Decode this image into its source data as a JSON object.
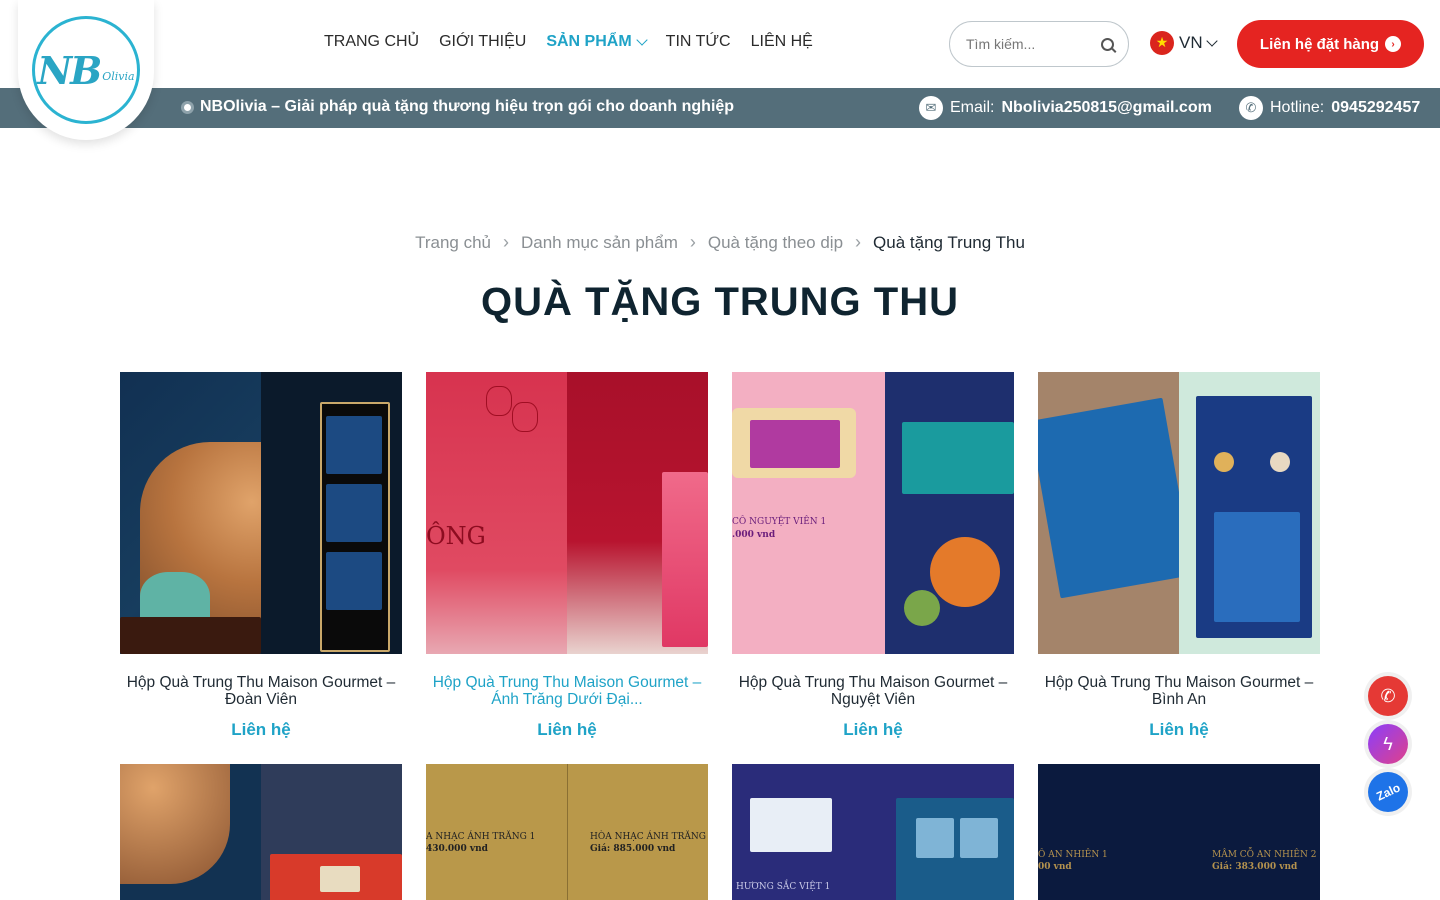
{
  "brand": {
    "logo_text": "NB",
    "logo_sub": "Olivia"
  },
  "nav": {
    "items": [
      {
        "label": "TRANG CHỦ"
      },
      {
        "label": "GIỚI THIỆU"
      },
      {
        "label": "SẢN PHẨM"
      },
      {
        "label": "TIN TỨC"
      },
      {
        "label": "LIÊN HỆ"
      }
    ]
  },
  "search": {
    "placeholder": "Tìm kiếm..."
  },
  "language": {
    "label": "VN"
  },
  "cta": {
    "label": "Liên hệ đặt hàng"
  },
  "infobar": {
    "tagline": "NBOlivia – Giải pháp quà tặng thương hiệu trọn gói cho doanh nghiệp",
    "email_label": "Email:",
    "email_value": "Nbolivia250815@gmail.com",
    "hotline_label": "Hotline:",
    "hotline_value": "0945292457"
  },
  "breadcrumb": {
    "items": [
      "Trang chủ",
      "Danh mục sản phẩm",
      "Quà tặng theo dịp"
    ],
    "current": "Quà tặng Trung Thu"
  },
  "page_title": "QUÀ TẶNG TRUNG THU",
  "products": [
    {
      "name": "Hộp Quà Trung Thu Maison Gourmet – Đoàn Viên",
      "price": "Liên hệ"
    },
    {
      "name": "Hộp Quà Trung Thu Maison Gourmet – Ánh Trăng Dưới Đại...",
      "price": "Liên hệ"
    },
    {
      "name": "Hộp Quà Trung Thu Maison Gourmet – Nguyệt Viên",
      "price": "Liên hệ"
    },
    {
      "name": "Hộp Quà Trung Thu Maison Gourmet – Bình An",
      "price": "Liên hệ"
    }
  ],
  "thumb_text": {
    "p2": "ÔNG",
    "p3_title": "CÔ NGUYỆT VIÊN 1",
    "p3_price": ".000 vnd",
    "r2_p2_left": "A NHẠC ÁNH TRĂNG 1",
    "r2_p2_left_price": "430.000 vnd",
    "r2_p2_right": "HÒA NHẠC ÁNH TRĂNG 2",
    "r2_p2_right_price": "Giá: 885.000 vnd",
    "r2_p3": "HƯƠNG SẮC VIỆT 1",
    "r2_p4_left": "Ô AN NHIÊN 1",
    "r2_p4_left_price": "00 vnd",
    "r2_p4_right": "MÂM CỖ AN NHIÊN 2",
    "r2_p4_right_price": "Giá: 383.000 vnd"
  },
  "floating": {
    "zalo_label": "Zalo"
  },
  "colors": {
    "accent": "#1fa3c7",
    "cta": "#e52421",
    "infobar": "#546e7a"
  }
}
